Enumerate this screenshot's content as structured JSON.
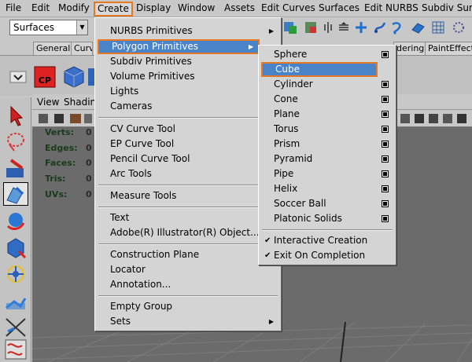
{
  "menubar": {
    "items": [
      "File",
      "Edit",
      "Modify",
      "Create",
      "Display",
      "Window",
      "Assets",
      "Edit Curves",
      "Surfaces",
      "Edit NURBS",
      "Subdiv Surfa"
    ],
    "selected": "Create"
  },
  "statusline": {
    "menuset_value": "Surfaces"
  },
  "shelf": {
    "tabs": [
      "General",
      "Curve",
      "dering",
      "PaintEffects"
    ],
    "cp_label": "CP"
  },
  "panel": {
    "menu": [
      "View",
      "Shadin"
    ]
  },
  "hud": [
    {
      "label": "Verts:",
      "value": "0"
    },
    {
      "label": "Edges:",
      "value": "0"
    },
    {
      "label": "Faces:",
      "value": "0"
    },
    {
      "label": "Tris:",
      "value": "0"
    },
    {
      "label": "UVs:",
      "value": "0"
    }
  ],
  "create_menu": {
    "items": [
      {
        "label": "NURBS Primitives",
        "submenu": true
      },
      {
        "label": "Polygon Primitives",
        "submenu": true,
        "highlighted": true
      },
      {
        "label": "Subdiv Primitives",
        "submenu": true
      },
      {
        "label": "Volume Primitives",
        "submenu": true
      },
      {
        "label": "Lights",
        "submenu": true
      },
      {
        "label": "Cameras",
        "submenu": true
      },
      {
        "label": "CV Curve Tool",
        "submenu": false
      },
      {
        "label": "EP Curve Tool",
        "submenu": false
      },
      {
        "label": "Pencil Curve Tool",
        "submenu": false
      },
      {
        "label": "Arc Tools",
        "submenu": true
      },
      {
        "label": "Measure Tools",
        "submenu": true
      },
      {
        "label": "Text",
        "submenu": false
      },
      {
        "label": "Adobe(R) Illustrator(R) Object...",
        "submenu": false
      },
      {
        "label": "Construction Plane",
        "submenu": false
      },
      {
        "label": "Locator",
        "submenu": false
      },
      {
        "label": "Annotation...",
        "submenu": false
      },
      {
        "label": "Empty Group",
        "submenu": false
      },
      {
        "label": "Sets",
        "submenu": true
      }
    ]
  },
  "polygon_menu": {
    "items": [
      {
        "label": "Sphere"
      },
      {
        "label": "Cube",
        "highlighted": true
      },
      {
        "label": "Cylinder"
      },
      {
        "label": "Cone"
      },
      {
        "label": "Plane"
      },
      {
        "label": "Torus"
      },
      {
        "label": "Prism"
      },
      {
        "label": "Pyramid"
      },
      {
        "label": "Pipe"
      },
      {
        "label": "Helix"
      },
      {
        "label": "Soccer Ball"
      },
      {
        "label": "Platonic Solids"
      }
    ],
    "toggles": [
      {
        "label": "Interactive Creation",
        "checked": true
      },
      {
        "label": "Exit On Completion",
        "checked": true
      }
    ]
  },
  "colors": {
    "highlight": "#4a84c8",
    "selection_outline": "#e87722",
    "menu_bg": "#d4d4d4"
  }
}
